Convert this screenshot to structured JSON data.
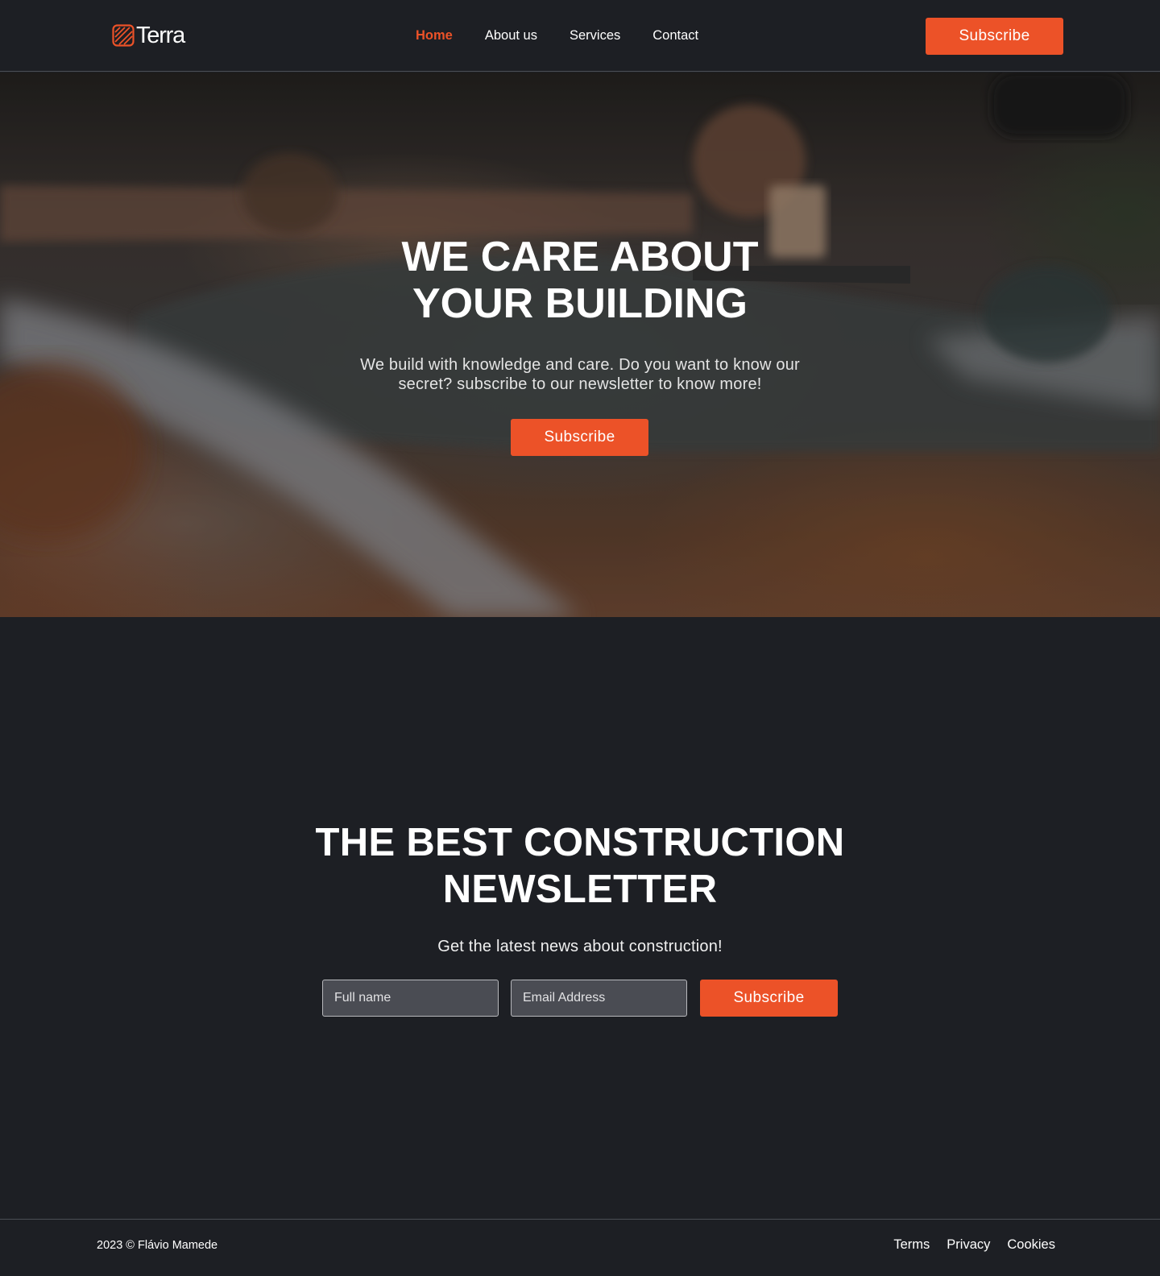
{
  "brand": {
    "name": "Terra",
    "icon": "terra-leaf-logo-icon",
    "accent": "#ec5228"
  },
  "nav": {
    "items": [
      {
        "label": "Home",
        "active": true
      },
      {
        "label": "About us",
        "active": false
      },
      {
        "label": "Services",
        "active": false
      },
      {
        "label": "Contact",
        "active": false
      }
    ],
    "subscribe_label": "Subscribe"
  },
  "hero": {
    "title": "WE CARE ABOUT YOUR BUILDING",
    "subtitle": "We build with knowledge and care. Do you want to know our secret? subscribe to our newsletter to know more!",
    "button_label": "Subscribe"
  },
  "newsletter": {
    "title": "THE BEST CONSTRUCTION NEWSLETTER",
    "subtitle": "Get the latest news about construction!",
    "name_placeholder": "Full name",
    "email_placeholder": "Email Address",
    "button_label": "Subscribe"
  },
  "footer": {
    "copyright": "2023 © Flávio Mamede",
    "links": [
      "Terms",
      "Privacy",
      "Cookies"
    ]
  },
  "colors": {
    "background": "#1d1f24",
    "accent": "#ec5228",
    "input_bg": "#4a4c53"
  }
}
